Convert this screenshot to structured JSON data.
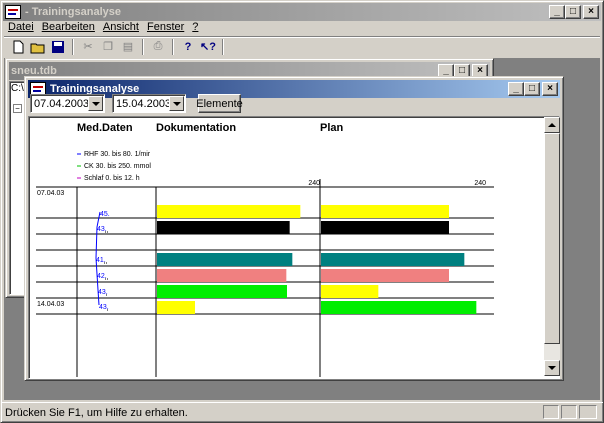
{
  "app": {
    "title": "- Trainingsanalyse",
    "menu": [
      "Datei",
      "Bearbeiten",
      "Ansicht",
      "Fenster",
      "?"
    ],
    "status": "Drücken Sie F1, um Hilfe zu erhalten."
  },
  "toolbar": {
    "icons": [
      "new-file-icon",
      "open-folder-icon",
      "save-icon",
      "cut-icon",
      "copy-icon",
      "paste-icon",
      "print-icon",
      "help-icon",
      "context-help-icon"
    ]
  },
  "bg_window": {
    "title": "sneu.tdb",
    "tree_root": "C:\\"
  },
  "analysis_window": {
    "title": "Trainingsanalyse",
    "date_from": "07.04.2003",
    "date_to": "15.04.2003",
    "elements_button": "Elemente"
  },
  "chart_data": {
    "type": "bar",
    "headers": {
      "med": "Med.Daten",
      "doc": "Dokumentation",
      "plan": "Plan"
    },
    "legend": [
      {
        "label": "RHF 30. bis 80. 1/mir",
        "color": "#0000ff"
      },
      {
        "label": "CK 30. bis 250. mmol",
        "color": "#00c000"
      },
      {
        "label": "Schlaf 0. bis 12. h",
        "color": "#c000c0"
      }
    ],
    "scale_max": 240,
    "dates": [
      "07.04.03",
      "14.04.03"
    ],
    "rhf_labels": [
      "45.",
      "43.",
      "41.",
      "42.",
      "43.",
      "43."
    ],
    "rows": [
      {
        "doc": 215,
        "doc_color": "#ffff00",
        "plan": 192,
        "plan_color": "#ffff00"
      },
      {
        "doc": 199,
        "doc_color": "#000000",
        "plan": 192,
        "plan_color": "#000000"
      },
      {
        "doc": 0,
        "doc_color": "",
        "plan": 0,
        "plan_color": ""
      },
      {
        "doc": 203,
        "doc_color": "#008080",
        "plan": 215,
        "plan_color": "#008080"
      },
      {
        "doc": 194,
        "doc_color": "#f08080",
        "plan": 192,
        "plan_color": "#f08080"
      },
      {
        "doc": 195,
        "doc_color": "#00ee00",
        "plan": 86,
        "plan_color": "#ffff00"
      },
      {
        "doc": 57,
        "doc_color": "#ffff00",
        "plan": 233,
        "plan_color": "#00ee00"
      }
    ]
  }
}
